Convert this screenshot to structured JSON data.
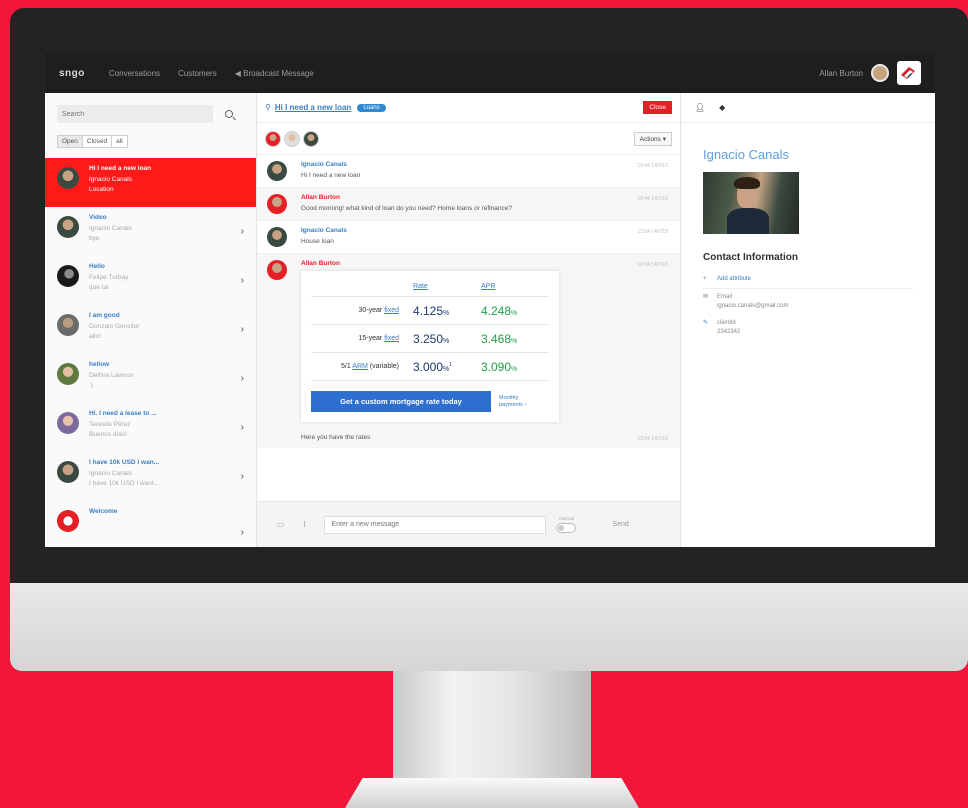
{
  "nav": {
    "logo": "sngo",
    "links": [
      "Conversations",
      "Customers",
      "Broadcast Message"
    ],
    "user": "Allan Burton"
  },
  "sidebar": {
    "search_placeholder": "Search",
    "filters": [
      "Open",
      "Closed",
      "all"
    ],
    "conversations": [
      {
        "title": "Hi I need a new loan",
        "line1": "Ignacio Canals",
        "line2": "Location",
        "active": true
      },
      {
        "title": "Video",
        "line1": "Ignacio Canals",
        "line2": "bye"
      },
      {
        "title": "Hello",
        "line1": "Felipe Turbay",
        "line2": "que tal"
      },
      {
        "title": "I am good",
        "line1": "Gonzalo Gensitor",
        "line2": "allo!"
      },
      {
        "title": "hellow",
        "line1": "Delfina Lawson",
        "line2": ":)"
      },
      {
        "title": "Hi. I need a lease to ...",
        "line1": "Teresita Pérez",
        "line2": "Buenos días!"
      },
      {
        "title": "I have 10k USD I wan...",
        "line1": "Ignacio Canals",
        "line2": "I have 10k USD I want..."
      },
      {
        "title": "Welcome",
        "line1": "",
        "line2": ""
      }
    ]
  },
  "conversation": {
    "title": "Hi I need a new loan",
    "tag": "Loans",
    "close_label": "Close",
    "actions_label": "Actions ▾",
    "messages": [
      {
        "name": "Ignacio Canals",
        "text": "Hi I need a new loan",
        "time": "10:44 14/7/15"
      },
      {
        "name": "Allan Burton",
        "text": "Good morning! what kind of loan do you need? Home loans or refinance?",
        "time": "10:44 14/7/15"
      },
      {
        "name": "Ignacio Canals",
        "text": "House loan",
        "time": "12:04 14/7/15"
      },
      {
        "name": "Allan Burton",
        "text": "",
        "time": "12:04 14/7/15"
      }
    ],
    "rates": {
      "col_rate": "Rate",
      "col_apr": "APR",
      "rows": [
        {
          "prefix": "30-year ",
          "link": "fixed",
          "suffix": "",
          "rate": "4.125",
          "apr": "4.248"
        },
        {
          "prefix": "15-year ",
          "link": "fixed",
          "suffix": "",
          "rate": "3.250",
          "apr": "3.468"
        },
        {
          "prefix": "5/1 ",
          "link": "ARM",
          "suffix": " (variable)",
          "rate": "3.000",
          "rate_note": "1",
          "apr": "3.090"
        }
      ],
      "cta_label": "Get a custom mortgage rate today",
      "side_line1": "Monthly",
      "side_line2": "payments ›"
    },
    "last_message": {
      "text": "Here you have the rates",
      "time": "12:04 14/7/15"
    },
    "composer_placeholder": "Enter a new message",
    "internal_label": "Internal",
    "send_label": "Send"
  },
  "contact": {
    "name": "Ignacio Canals",
    "section_title": "Contact Information",
    "add_attribute": "Add attribute",
    "email_label": "Email",
    "email_value": "ignacio.canals@gmail.com",
    "clientid_label": "clientid",
    "clientid_value": "2342342"
  },
  "colors": {
    "accent_red": "#e41f25",
    "link_blue": "#3a7ec6",
    "rate_green": "#20a04a",
    "background_red": "#f2163a"
  }
}
